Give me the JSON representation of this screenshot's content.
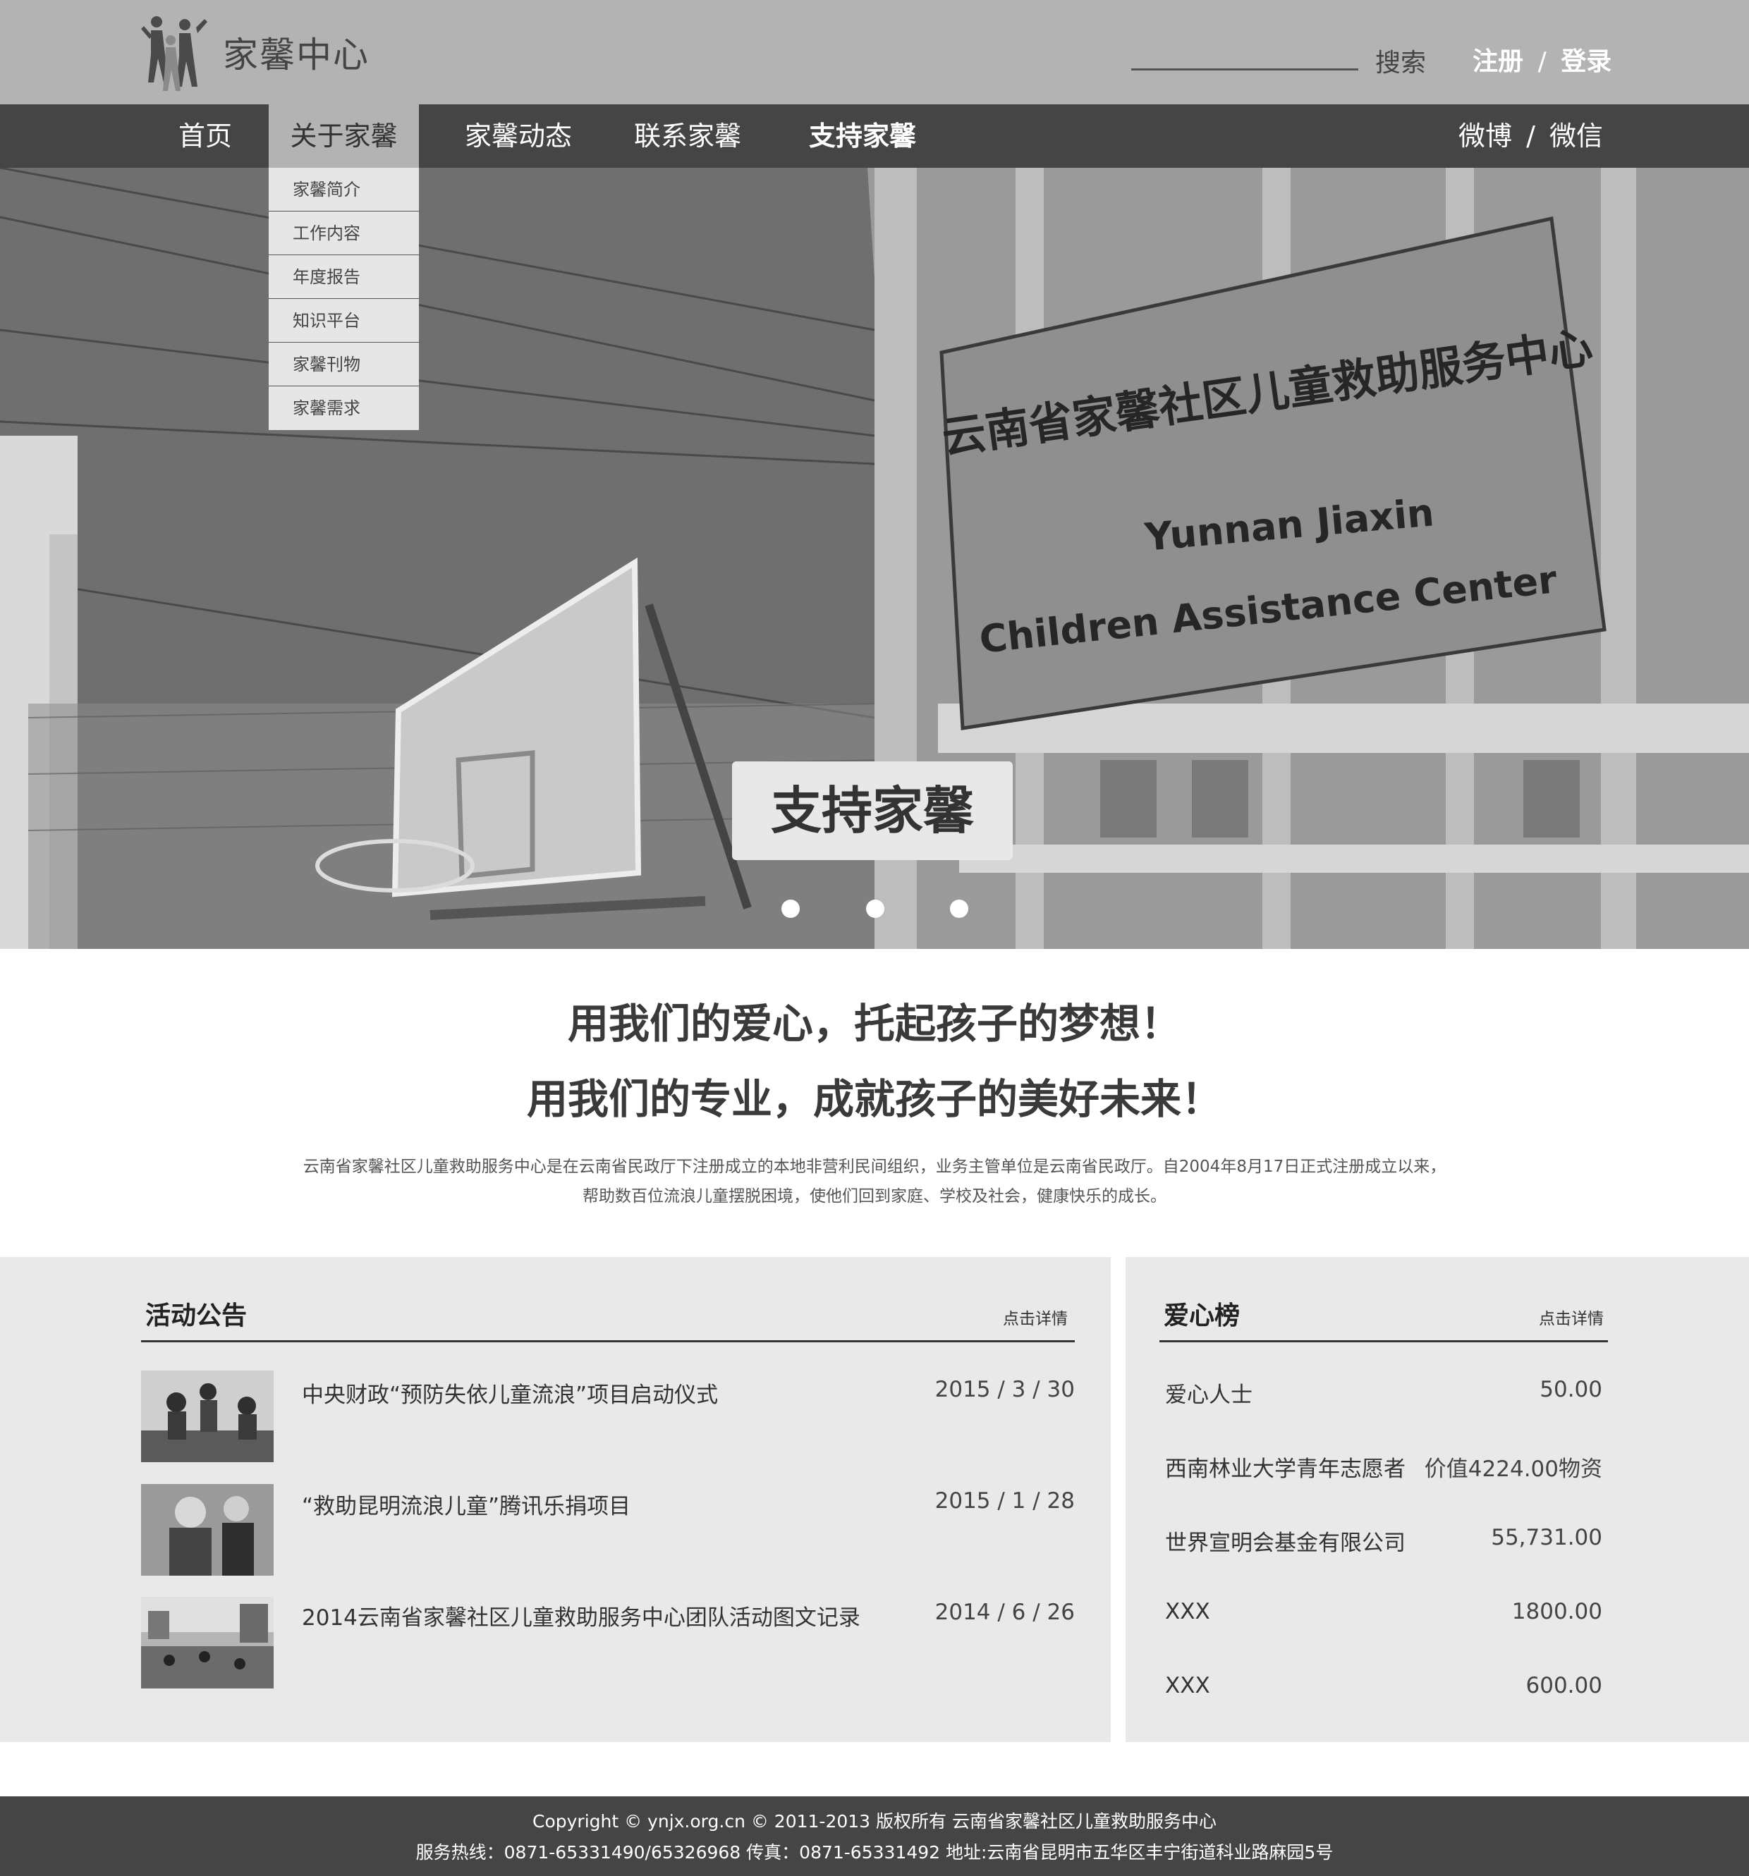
{
  "header": {
    "logo_text": "家馨中心",
    "search_label": "搜索",
    "register_label": "注册",
    "auth_separator": "/",
    "login_label": "登录"
  },
  "nav": {
    "items": [
      {
        "label": "首页"
      },
      {
        "label": "关于家馨"
      },
      {
        "label": "家馨动态"
      },
      {
        "label": "联系家馨"
      },
      {
        "label": "支持家馨"
      }
    ],
    "weibo_label": "微博",
    "social_separator": "/",
    "wechat_label": "微信",
    "dropdown": [
      "家馨简介",
      "工作内容",
      "年度报告",
      "知识平台",
      "家馨刊物",
      "家馨需求"
    ]
  },
  "hero": {
    "sign_cn": "云南省家馨社区儿童救助服务中心",
    "sign_en_line1": "Yunnan Jiaxin",
    "sign_en_line2": "Children Assistance Center",
    "cta_label": "支持家馨",
    "slide_count": 3
  },
  "mission": {
    "line1": "用我们的爱心，托起孩子的梦想！",
    "line2": "用我们的专业，成就孩子的美好未来！",
    "intro_line1": "云南省家馨社区儿童救助服务中心是在云南省民政厅下注册成立的本地非营利民间组织，业务主管单位是云南省民政厅。自2004年8月17日正式注册成立以来，",
    "intro_line2": "帮助数百位流浪儿童摆脱困境，使他们回到家庭、学校及社会，健康快乐的成长。"
  },
  "activities": {
    "title": "活动公告",
    "more_label": "点击详情",
    "items": [
      {
        "title": "中央财政“预防失依儿童流浪”项目启动仪式",
        "date": "2015 / 3 / 30"
      },
      {
        "title": "“救助昆明流浪儿童”腾讯乐捐项目",
        "date": "2015 / 1 / 28"
      },
      {
        "title": "2014云南省家馨社区儿童救助服务中心团队活动图文记录",
        "date": "2014 / 6 / 26"
      }
    ]
  },
  "donors": {
    "title": "爱心榜",
    "more_label": "点击详情",
    "items": [
      {
        "name": "爱心人士",
        "amount": "50.00"
      },
      {
        "name": "西南林业大学青年志愿者",
        "amount": "价值4224.00物资"
      },
      {
        "name": "世界宣明会基金有限公司",
        "amount": "55,731.00"
      },
      {
        "name": "XXX",
        "amount": "1800.00"
      },
      {
        "name": "XXX",
        "amount": "600.00"
      }
    ]
  },
  "footer": {
    "line1": "Copyright © ynjx.org.cn © 2011-2013 版权所有 云南省家馨社区儿童救助服务中心",
    "line2": "服务热线：0871-65331490/65326968 传真：0871-65331492 地址:云南省昆明市五华区丰宁街道科业路麻园5号"
  },
  "colors": {
    "topbar": "#b3b3b3",
    "navbar": "#454545",
    "panel": "#e9e9e9",
    "footer": "#454545"
  }
}
